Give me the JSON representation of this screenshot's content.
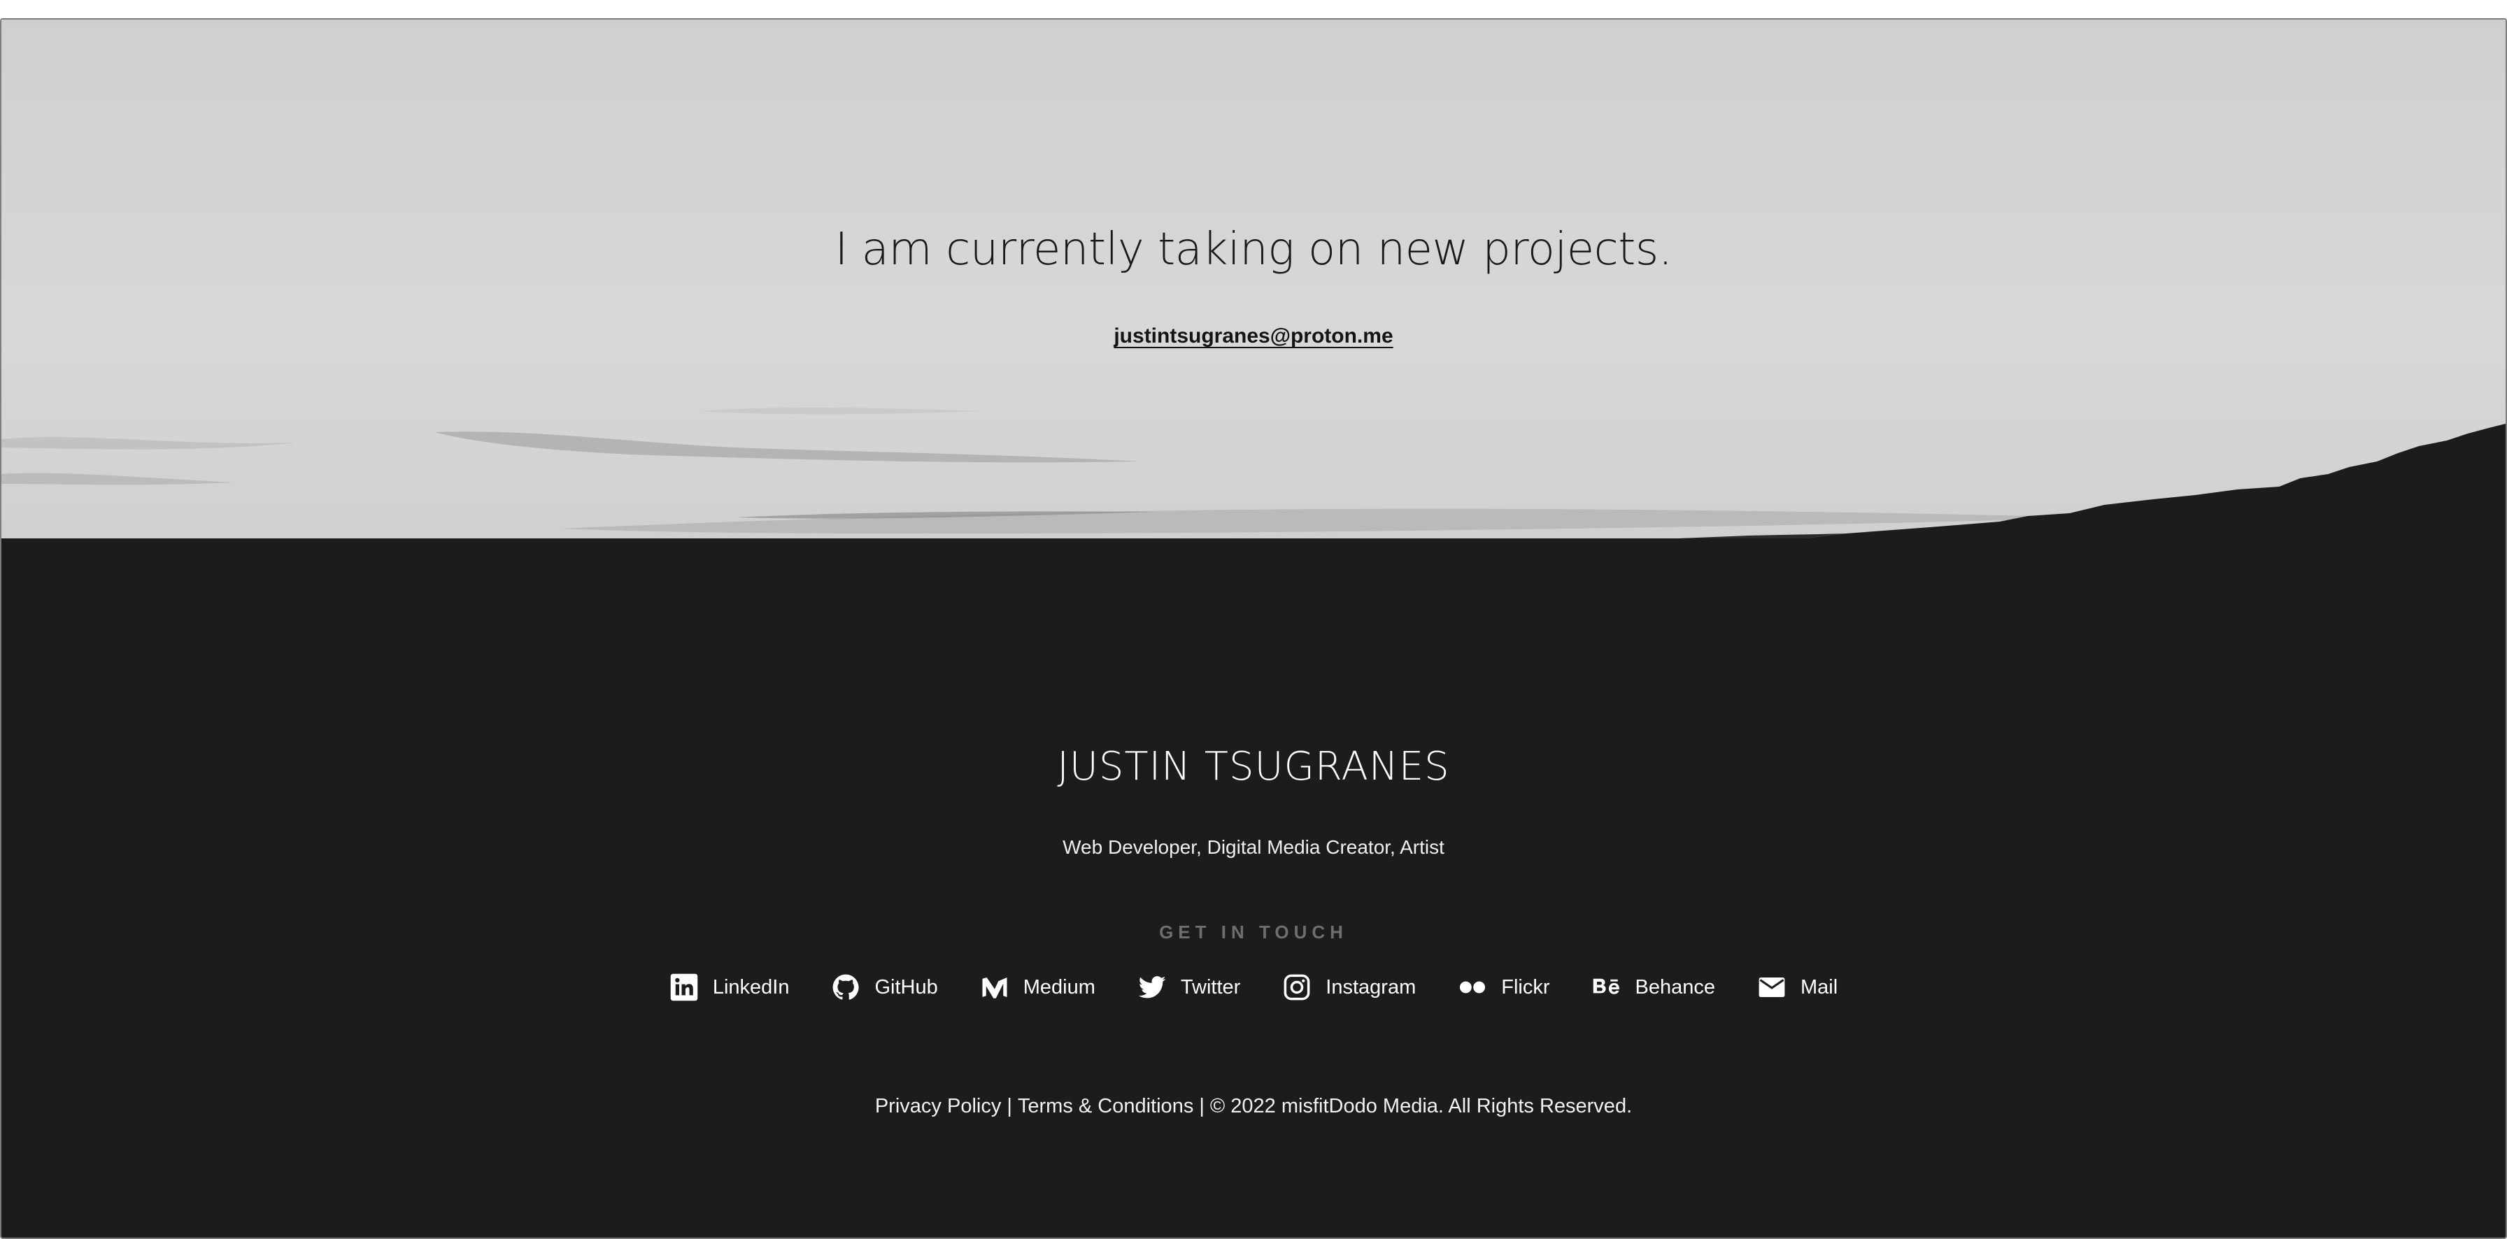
{
  "hero": {
    "headline": "I am currently taking on new projects.",
    "email": "justintsugranes@proton.me"
  },
  "footer": {
    "name": "JUSTIN TSUGRANES",
    "tagline": "Web Developer, Digital Media Creator, Artist",
    "contact_heading": "GET IN TOUCH",
    "social": [
      {
        "label": "LinkedIn",
        "icon": "linkedin-icon"
      },
      {
        "label": "GitHub",
        "icon": "github-icon"
      },
      {
        "label": "Medium",
        "icon": "medium-icon"
      },
      {
        "label": "Twitter",
        "icon": "twitter-icon"
      },
      {
        "label": "Instagram",
        "icon": "instagram-icon"
      },
      {
        "label": "Flickr",
        "icon": "flickr-icon"
      },
      {
        "label": "Behance",
        "icon": "behance-icon"
      },
      {
        "label": "Mail",
        "icon": "mail-icon"
      }
    ],
    "legal": {
      "privacy": "Privacy Policy",
      "separator": "|",
      "terms": "Terms & Conditions",
      "copyright": "© 2022 misfitDodo Media. All Rights Reserved."
    }
  },
  "colors": {
    "footer_bg": "#1c1c1c",
    "hero_sky": "#d6d6d6",
    "heading_muted": "#6e6e6e"
  }
}
